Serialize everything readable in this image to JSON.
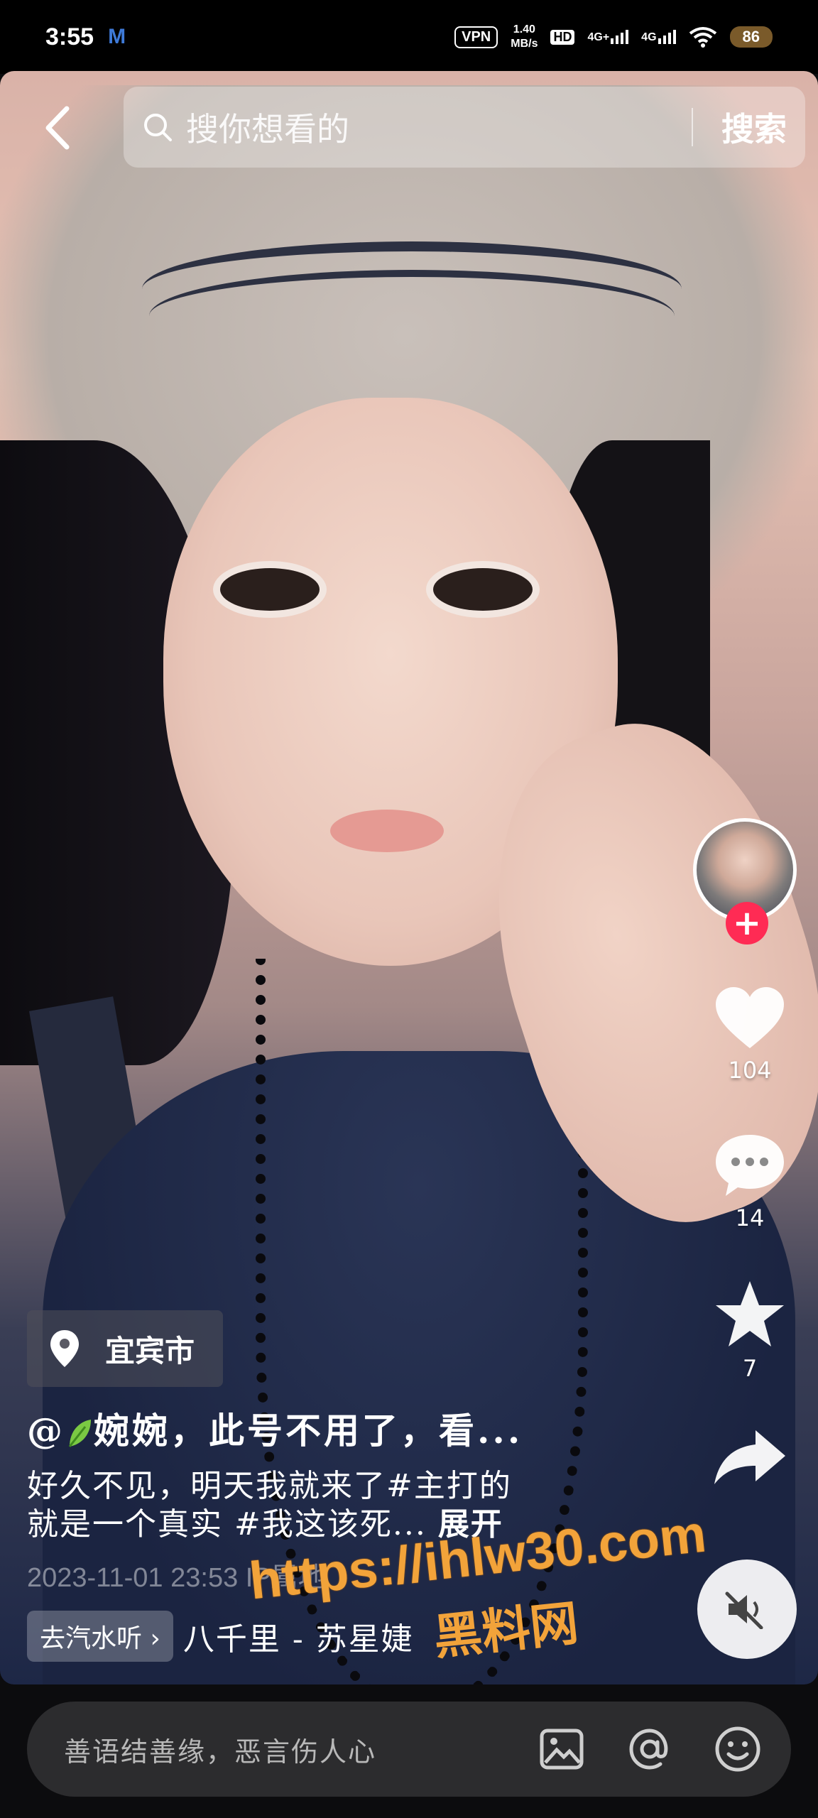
{
  "status_bar": {
    "time": "3:55",
    "m_icon": "M",
    "vpn": "VPN",
    "speed_value": "1.40",
    "speed_unit": "MB/s",
    "hd": "HD",
    "net1": "4G+",
    "net2": "4G",
    "battery": "86"
  },
  "search": {
    "placeholder": "搜你想看的",
    "button_label": "搜索"
  },
  "actions": {
    "likes": "104",
    "comments": "14",
    "favorites": "7"
  },
  "location": "宜宾市",
  "caption": {
    "author": "@🍃婉婉，此号不用了，看...",
    "author_prefix": "@",
    "author_name": "婉婉，此号不用了，看...",
    "description_line1": "好久不见，明天我就来了#主打的",
    "description_line2": "就是一个真实 #我这该死...",
    "expand_label": "展开",
    "date": "2023-11-01 23:53  IP属地",
    "music_chip": "去汽水听 ›",
    "music_title": "八千里 - 苏星婕"
  },
  "watermark": {
    "url": "https://ihlw30.com",
    "name": "黑料网"
  },
  "comment": {
    "placeholder": "善语结善缘，恶言伤人心"
  },
  "colors": {
    "follow": "#ff2b54",
    "watermark": "#f2a33a"
  }
}
